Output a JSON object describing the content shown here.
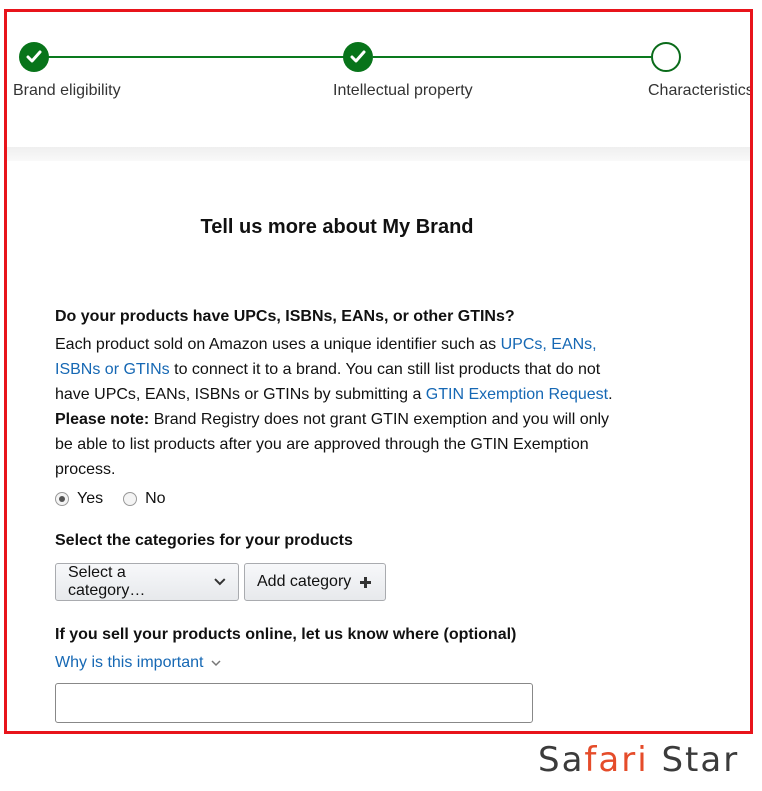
{
  "stepper": {
    "steps": [
      {
        "label": "Brand eligibility",
        "status": "completed"
      },
      {
        "label": "Intellectual property",
        "status": "completed"
      },
      {
        "label": "Characteristics",
        "status": "current"
      }
    ],
    "color": "#0a7a1e"
  },
  "page": {
    "heading": "Tell us more about My Brand"
  },
  "gtin": {
    "question": "Do your products have UPCs, ISBNs, EANs, or other GTINs?",
    "text1": "Each product sold on Amazon uses a unique identifier such as ",
    "link1": "UPCs, EANs, ISBNs or GTINs",
    "text2": " to connect it to a brand. You can still list products that do not have UPCs, EANs, ISBNs or GTINs by submitting a ",
    "link2": "GTIN Exemption Request",
    "text3": ".",
    "note_label": "Please note:",
    "note_text": " Brand Registry does not grant GTIN exemption and you will only be able to list products after you are approved through the GTIN Exemption process.",
    "options": [
      {
        "label": "Yes",
        "selected": true
      },
      {
        "label": "No",
        "selected": false
      }
    ]
  },
  "categories": {
    "title": "Select the categories for your products",
    "select_value": "Select a category…",
    "add_label": "Add category"
  },
  "online": {
    "title": "If you sell your products online, let us know where (optional)",
    "why_link": "Why is this important",
    "input_value": ""
  },
  "watermark": {
    "part1": "Sa",
    "part2": "fari",
    "part3": " Star",
    "accent_color": "#e54c2a"
  }
}
